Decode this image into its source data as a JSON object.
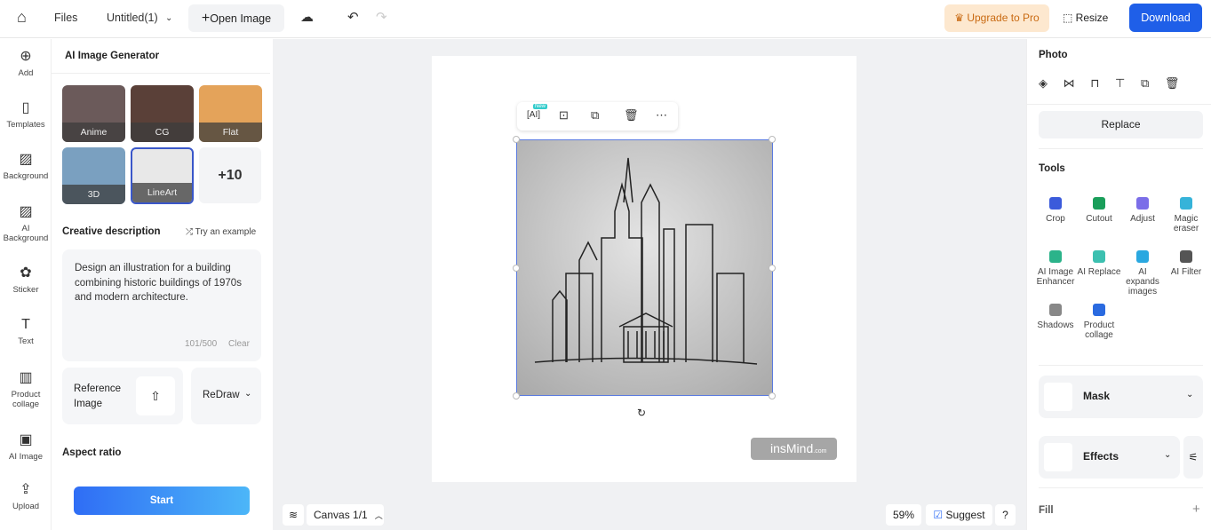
{
  "topbar": {
    "files": "Files",
    "doc_title": "Untitled(1)",
    "open_image": "Open Image",
    "upgrade": "Upgrade to Pro",
    "resize": "Resize",
    "download": "Download"
  },
  "rail": [
    {
      "label": "Add",
      "icon": "plus-circle-icon"
    },
    {
      "label": "Templates",
      "icon": "templates-icon"
    },
    {
      "label": "Background",
      "icon": "background-icon"
    },
    {
      "label": "AI Background",
      "icon": "ai-background-icon"
    },
    {
      "label": "Sticker",
      "icon": "sticker-icon"
    },
    {
      "label": "Text",
      "icon": "text-icon"
    },
    {
      "label": "Product collage",
      "icon": "collage-icon"
    },
    {
      "label": "AI Image",
      "icon": "ai-image-icon"
    },
    {
      "label": "Upload",
      "icon": "upload-icon"
    }
  ],
  "panel": {
    "title": "AI Image Generator",
    "styles": [
      {
        "label": "Anime",
        "color": "#6b5a5a"
      },
      {
        "label": "CG",
        "color": "#5a4038"
      },
      {
        "label": "Flat",
        "color": "#e4a35a"
      },
      {
        "label": "3D",
        "color": "#7aa0c0"
      },
      {
        "label": "LineArt",
        "color": "#e8e8e8",
        "selected": true
      }
    ],
    "more_styles": "+10",
    "desc_label": "Creative description",
    "try_example": "Try an example",
    "description": "Design an illustration for a building combining historic buildings of 1970s  and modern architecture.",
    "char_count": "101/500",
    "clear": "Clear",
    "reference_image": "Reference Image",
    "redraw": "ReDraw",
    "aspect_ratio": "Aspect ratio",
    "start": "Start"
  },
  "canvas": {
    "watermark": "insMind",
    "watermark_suffix": ".com",
    "new_badge": "New",
    "canvas_label": "Canvas 1/1",
    "zoom": "59%",
    "suggest": "Suggest",
    "help": "?"
  },
  "right": {
    "photo": "Photo",
    "replace": "Replace",
    "tools_title": "Tools",
    "tools": [
      {
        "label": "Crop",
        "color": "#3b5bdb"
      },
      {
        "label": "Cutout",
        "color": "#1a9e5a"
      },
      {
        "label": "Adjust",
        "color": "#7b6ee8"
      },
      {
        "label": "Magic eraser",
        "color": "#36b3d9"
      },
      {
        "label": "AI Image Enhancer",
        "color": "#2bb38a"
      },
      {
        "label": "AI Replace",
        "color": "#3cc0b0"
      },
      {
        "label": "AI expands images",
        "color": "#2aa8e0"
      },
      {
        "label": "AI Filter",
        "color": "#555555"
      },
      {
        "label": "Shadows",
        "color": "#888888"
      },
      {
        "label": "Product collage",
        "color": "#2a6ae0"
      }
    ],
    "mask": "Mask",
    "effects": "Effects",
    "fill": "Fill"
  }
}
